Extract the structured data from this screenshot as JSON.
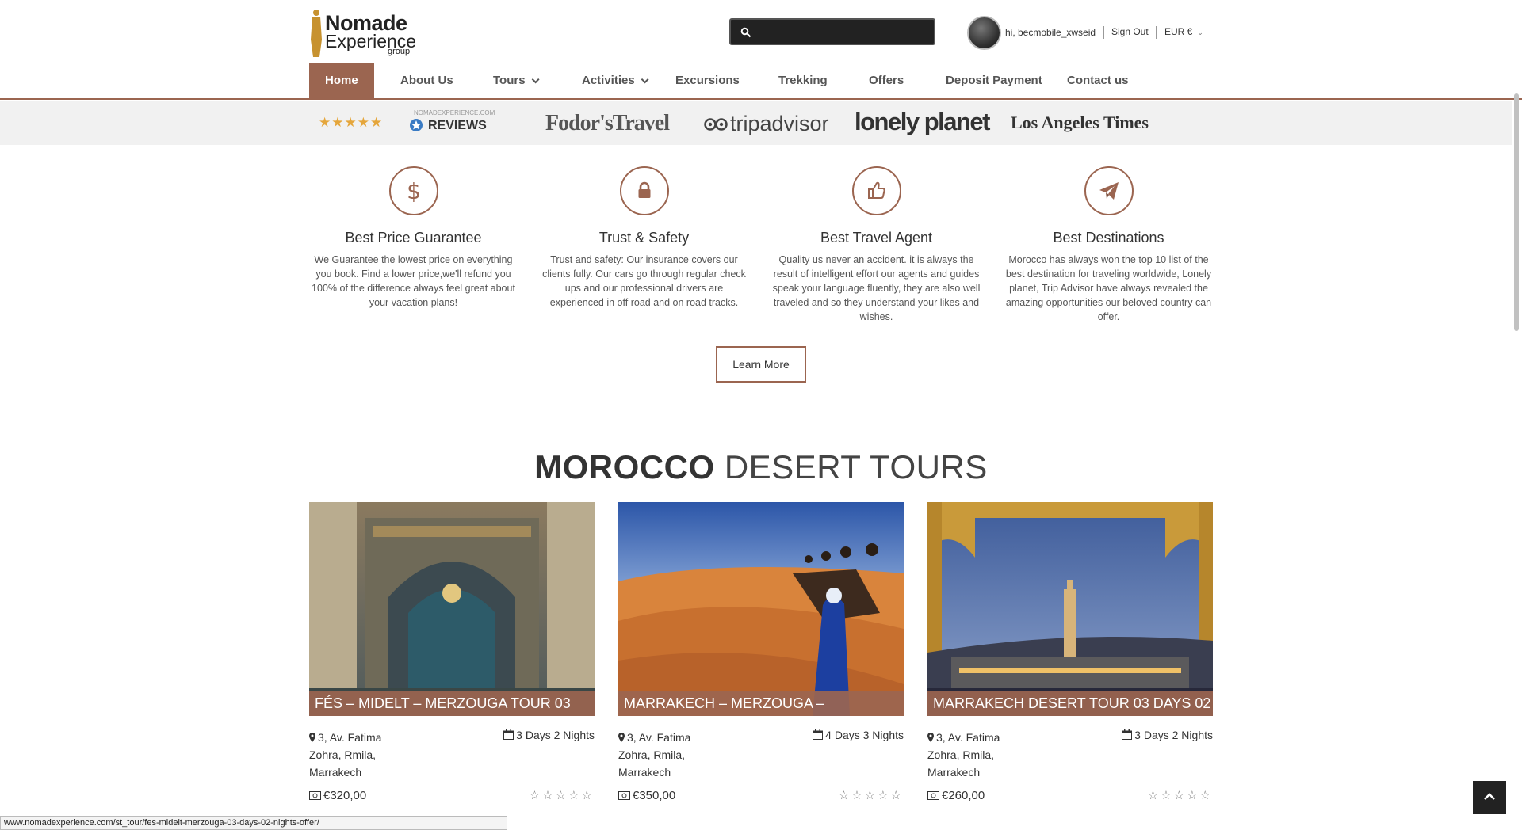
{
  "logo": {
    "line1": "Nomade",
    "line2": "Experience",
    "line3": "group"
  },
  "header": {
    "search": {
      "placeholder": "",
      "value": ""
    },
    "user_greeting": "hi, becmobile_xwseid",
    "sign_out": "Sign Out",
    "currency": "EUR €"
  },
  "nav": {
    "items": [
      {
        "label": "Home",
        "active": true
      },
      {
        "label": "About Us"
      },
      {
        "label": "Tours",
        "dropdown": true
      },
      {
        "label": "Activities",
        "dropdown": true
      },
      {
        "label": "Excursions"
      },
      {
        "label": "Trekking"
      },
      {
        "label": "Offers"
      },
      {
        "label": "Deposit Payment"
      },
      {
        "label": "Contact us"
      }
    ]
  },
  "press": {
    "stars": "★★★★★",
    "reviews_small": "NOMADEXPERIENCE.COM",
    "reviews_label": "REVIEWS",
    "logos": [
      "Fodor'sTravel",
      "tripadvisor",
      "lonely planet",
      "Los Angeles Times"
    ]
  },
  "features": [
    {
      "icon": "dollar-icon",
      "title": "Best Price Guarantee",
      "desc": "We Guarantee the lowest price on everything you book. Find a lower price,we'll refund you 100% of the difference always feel great about your vacation plans!"
    },
    {
      "icon": "lock-icon",
      "title": "Trust & Safety",
      "desc": "Trust and safety: Our insurance covers our clients fully. Our cars go through regular check ups and our professional drivers are experienced in off road and on road tracks."
    },
    {
      "icon": "thumbs-up-icon",
      "title": "Best Travel Agent",
      "desc": "Quality us never an accident. it is always the result of intelligent effort our agents and guides speak your language fluently, they are also well traveled and so they understand your likes and wishes."
    },
    {
      "icon": "paper-plane-icon",
      "title": "Best Destinations",
      "desc": "Morocco has always won the top 10 list of the best destination for traveling worldwide, Lonely planet, Trip Advisor have always revealed the amazing opportunities our beloved country can offer."
    }
  ],
  "learn_more": "Learn More",
  "section": {
    "title_bold": "MOROCCO",
    "title_rest": "DESERT TOURS"
  },
  "tours": [
    {
      "title": "FÉS – MIDELT – MERZOUGA TOUR 03",
      "address": "3, Av. Fatima Zohra, Rmila, Marrakech",
      "duration": "3 Days 2 Nights",
      "price": "€320,00",
      "stars": "☆☆☆☆☆"
    },
    {
      "title": "MARRAKECH – MERZOUGA –",
      "address": "3, Av. Fatima Zohra, Rmila, Marrakech",
      "duration": "4 Days 3 Nights",
      "price": "€350,00",
      "stars": "☆☆☆☆☆"
    },
    {
      "title": "MARRAKECH DESERT TOUR 03 DAYS 02",
      "address": "3, Av. Fatima Zohra, Rmila, Marrakech",
      "duration": "3 Days 2 Nights",
      "price": "€260,00",
      "stars": "☆☆☆☆☆"
    }
  ],
  "status_url": "www.nomadexperience.com/st_tour/fes-midelt-merzouga-03-days-02-nights-offer/",
  "colors": {
    "accent": "#9b6550",
    "star_gold": "#e5a63b"
  }
}
